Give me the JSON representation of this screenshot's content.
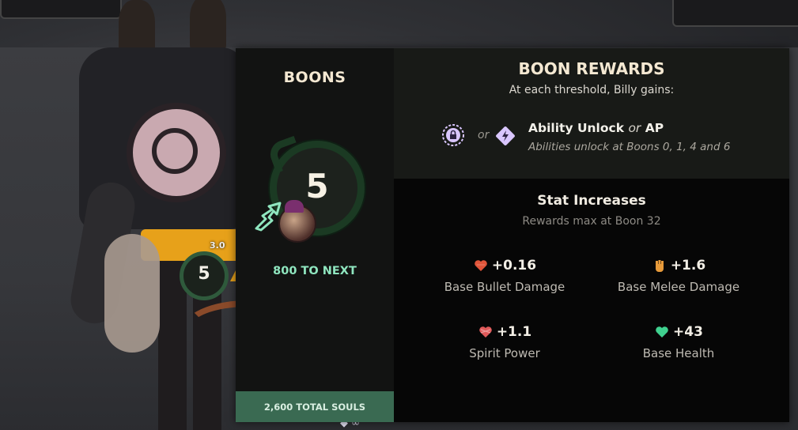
{
  "left": {
    "title": "BOONS",
    "boon_level": "5",
    "to_next": "800 TO NEXT",
    "total_souls": "2,600 TOTAL SOULS"
  },
  "rewards": {
    "title": "BOON REWARDS",
    "subtitle": "At each threshold, Billy gains:",
    "or_text": "or",
    "ability_unlock": "Ability Unlock",
    "or_text_2": "or",
    "ap": "AP",
    "ability_note": "Abilities unlock at Boons 0, 1, 4 and 6"
  },
  "stats": {
    "title": "Stat Increases",
    "subtitle": "Rewards max at Boon 32",
    "items": [
      {
        "value": "+0.16",
        "label": "Base Bullet Damage",
        "icon": "bullet-damage-icon",
        "color": "#e0553a"
      },
      {
        "value": "+1.6",
        "label": "Base Melee Damage",
        "icon": "melee-fist-icon",
        "color": "#e79a3a"
      },
      {
        "value": "+1.1",
        "label": "Spirit Power",
        "icon": "spirit-power-icon",
        "color": "#e05a5a"
      },
      {
        "value": "+43",
        "label": "Base Health",
        "icon": "health-heart-icon",
        "color": "#3fd18f"
      }
    ]
  },
  "world": {
    "level_badge": "5",
    "version": "3.0"
  },
  "colors": {
    "accent_green": "#8fe6bf",
    "total_bar": "#3a6a52",
    "icon_purple": "#d9c6ff"
  }
}
